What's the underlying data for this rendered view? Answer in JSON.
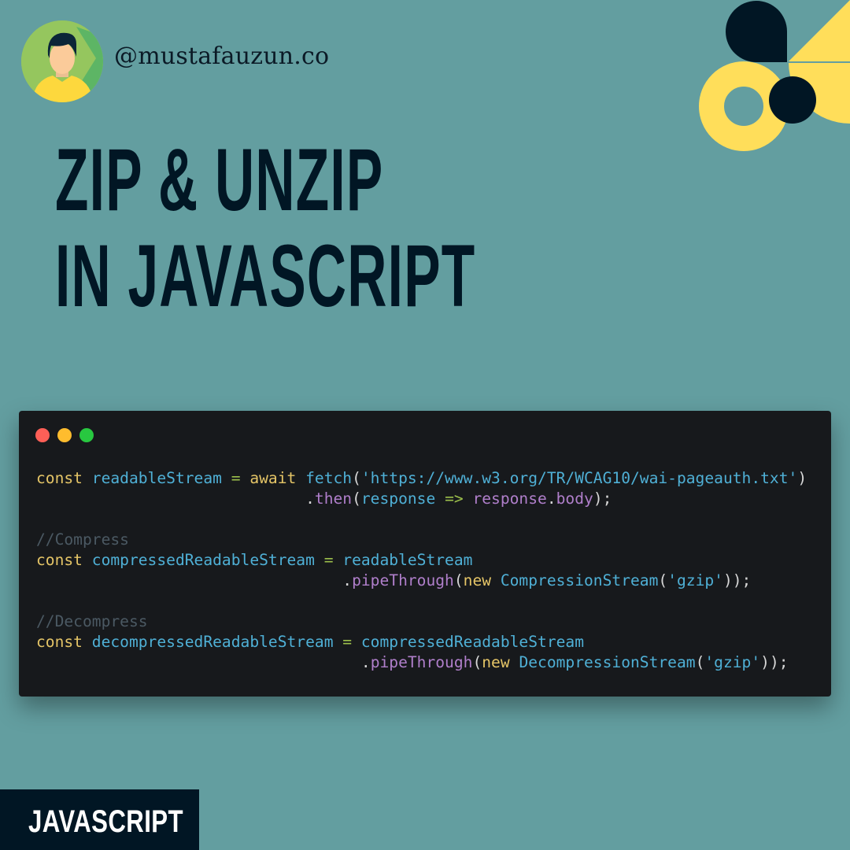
{
  "author": {
    "handle": "@mustafauzun.co",
    "avatar_icon": "person-avatar-icon"
  },
  "title": {
    "line1": "ZIP & UNZIP",
    "line2": "IN JAVASCRIPT"
  },
  "code_window": {
    "window_buttons": [
      {
        "name": "close",
        "color": "#fe5f57"
      },
      {
        "name": "minimize",
        "color": "#febc2e"
      },
      {
        "name": "maximize",
        "color": "#28c840"
      }
    ],
    "colors": {
      "keyword": "#e5c567",
      "identifier": "#4fb0d6",
      "string": "#4fb0d6",
      "method": "#b07fcb",
      "operator": "#9cc04b",
      "punct": "#d8d8d8",
      "comment": "#4b5963"
    },
    "lines": [
      [
        {
          "t": "const",
          "c": "keyword"
        },
        {
          "t": " ",
          "c": "punct"
        },
        {
          "t": "readableStream",
          "c": "identifier"
        },
        {
          "t": " ",
          "c": "punct"
        },
        {
          "t": "=",
          "c": "operator"
        },
        {
          "t": " ",
          "c": "punct"
        },
        {
          "t": "await",
          "c": "keyword"
        },
        {
          "t": " ",
          "c": "punct"
        },
        {
          "t": "fetch",
          "c": "identifier"
        },
        {
          "t": "(",
          "c": "punct"
        },
        {
          "t": "'https://www.w3.org/TR/WCAG10/wai-pageauth.txt'",
          "c": "string"
        },
        {
          "t": ")",
          "c": "punct"
        }
      ],
      [
        {
          "t": "                             ",
          "c": "punct"
        },
        {
          "t": ".",
          "c": "punct"
        },
        {
          "t": "then",
          "c": "method"
        },
        {
          "t": "(",
          "c": "punct"
        },
        {
          "t": "response",
          "c": "identifier"
        },
        {
          "t": " ",
          "c": "punct"
        },
        {
          "t": "=>",
          "c": "operator"
        },
        {
          "t": " ",
          "c": "punct"
        },
        {
          "t": "response",
          "c": "method"
        },
        {
          "t": ".",
          "c": "punct"
        },
        {
          "t": "body",
          "c": "method"
        },
        {
          "t": ");",
          "c": "punct"
        }
      ],
      [],
      [
        {
          "t": "//Compress",
          "c": "comment"
        }
      ],
      [
        {
          "t": "const",
          "c": "keyword"
        },
        {
          "t": " ",
          "c": "punct"
        },
        {
          "t": "compressedReadableStream",
          "c": "identifier"
        },
        {
          "t": " ",
          "c": "punct"
        },
        {
          "t": "=",
          "c": "operator"
        },
        {
          "t": " ",
          "c": "punct"
        },
        {
          "t": "readableStream",
          "c": "identifier"
        }
      ],
      [
        {
          "t": "                                 ",
          "c": "punct"
        },
        {
          "t": ".",
          "c": "punct"
        },
        {
          "t": "pipeThrough",
          "c": "method"
        },
        {
          "t": "(",
          "c": "punct"
        },
        {
          "t": "new",
          "c": "keyword"
        },
        {
          "t": " ",
          "c": "punct"
        },
        {
          "t": "CompressionStream",
          "c": "identifier"
        },
        {
          "t": "(",
          "c": "punct"
        },
        {
          "t": "'gzip'",
          "c": "string"
        },
        {
          "t": "));",
          "c": "punct"
        }
      ],
      [],
      [
        {
          "t": "//Decompress",
          "c": "comment"
        }
      ],
      [
        {
          "t": "const",
          "c": "keyword"
        },
        {
          "t": " ",
          "c": "punct"
        },
        {
          "t": "decompressedReadableStream",
          "c": "identifier"
        },
        {
          "t": " ",
          "c": "punct"
        },
        {
          "t": "=",
          "c": "operator"
        },
        {
          "t": " ",
          "c": "punct"
        },
        {
          "t": "compressedReadableStream",
          "c": "identifier"
        }
      ],
      [
        {
          "t": "                                   ",
          "c": "punct"
        },
        {
          "t": ".",
          "c": "punct"
        },
        {
          "t": "pipeThrough",
          "c": "method"
        },
        {
          "t": "(",
          "c": "punct"
        },
        {
          "t": "new",
          "c": "keyword"
        },
        {
          "t": " ",
          "c": "punct"
        },
        {
          "t": "DecompressionStream",
          "c": "identifier"
        },
        {
          "t": "(",
          "c": "punct"
        },
        {
          "t": "'gzip'",
          "c": "string"
        },
        {
          "t": "));",
          "c": "punct"
        }
      ]
    ]
  },
  "tag": {
    "label": "JAVASCRIPT"
  },
  "palette": {
    "background": "#639ea0",
    "dark": "#011624",
    "yellow": "#ffde5a"
  }
}
